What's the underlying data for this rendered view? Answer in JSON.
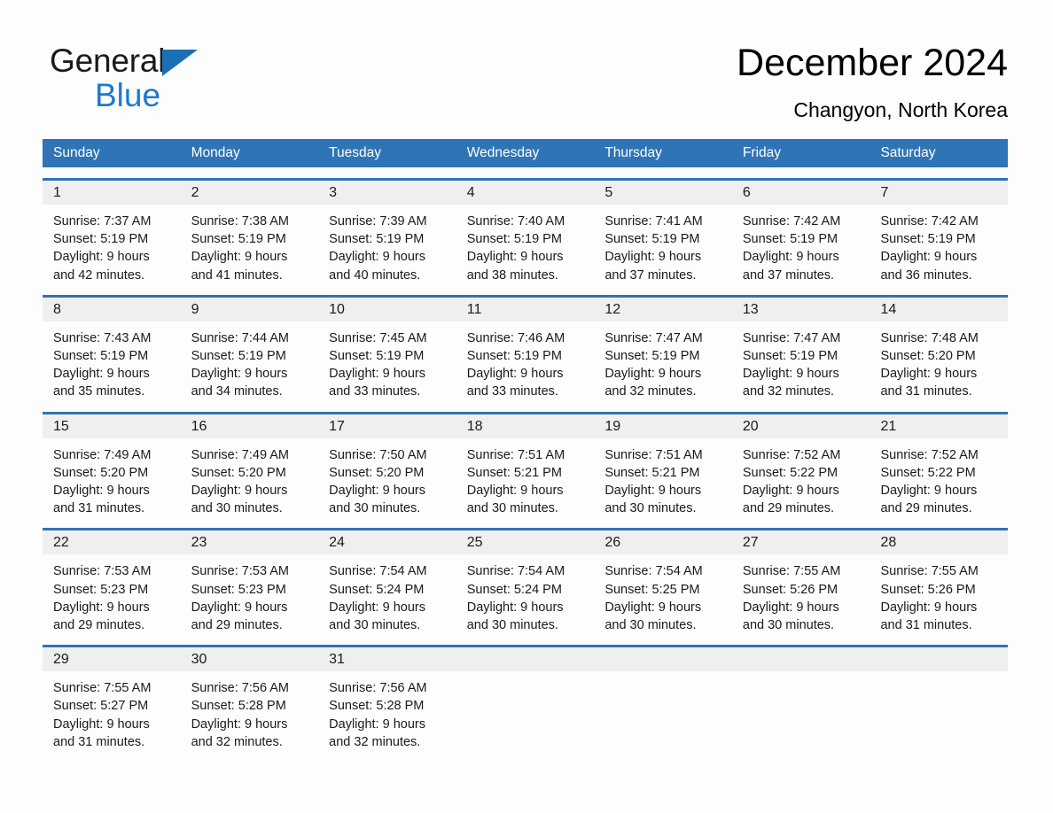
{
  "brand": {
    "name_part1": "General",
    "name_part2": "Blue",
    "triangle_icon": "blue-triangle-icon",
    "accent_color": "#1b7ad0"
  },
  "header": {
    "title": "December 2024",
    "subtitle": "Changyon, North Korea"
  },
  "theme": {
    "header_blue": "#2f74b5",
    "day_band_gray": "#efefef",
    "text_color": "#1a1a1a",
    "page_background": "#fdfdfd"
  },
  "calendar": {
    "weekday_headers": [
      "Sunday",
      "Monday",
      "Tuesday",
      "Wednesday",
      "Thursday",
      "Friday",
      "Saturday"
    ],
    "weeks": [
      [
        {
          "day": "1",
          "sunrise": "Sunrise: 7:37 AM",
          "sunset": "Sunset: 5:19 PM",
          "daylight_line1": "Daylight: 9 hours",
          "daylight_line2": "and 42 minutes."
        },
        {
          "day": "2",
          "sunrise": "Sunrise: 7:38 AM",
          "sunset": "Sunset: 5:19 PM",
          "daylight_line1": "Daylight: 9 hours",
          "daylight_line2": "and 41 minutes."
        },
        {
          "day": "3",
          "sunrise": "Sunrise: 7:39 AM",
          "sunset": "Sunset: 5:19 PM",
          "daylight_line1": "Daylight: 9 hours",
          "daylight_line2": "and 40 minutes."
        },
        {
          "day": "4",
          "sunrise": "Sunrise: 7:40 AM",
          "sunset": "Sunset: 5:19 PM",
          "daylight_line1": "Daylight: 9 hours",
          "daylight_line2": "and 38 minutes."
        },
        {
          "day": "5",
          "sunrise": "Sunrise: 7:41 AM",
          "sunset": "Sunset: 5:19 PM",
          "daylight_line1": "Daylight: 9 hours",
          "daylight_line2": "and 37 minutes."
        },
        {
          "day": "6",
          "sunrise": "Sunrise: 7:42 AM",
          "sunset": "Sunset: 5:19 PM",
          "daylight_line1": "Daylight: 9 hours",
          "daylight_line2": "and 37 minutes."
        },
        {
          "day": "7",
          "sunrise": "Sunrise: 7:42 AM",
          "sunset": "Sunset: 5:19 PM",
          "daylight_line1": "Daylight: 9 hours",
          "daylight_line2": "and 36 minutes."
        }
      ],
      [
        {
          "day": "8",
          "sunrise": "Sunrise: 7:43 AM",
          "sunset": "Sunset: 5:19 PM",
          "daylight_line1": "Daylight: 9 hours",
          "daylight_line2": "and 35 minutes."
        },
        {
          "day": "9",
          "sunrise": "Sunrise: 7:44 AM",
          "sunset": "Sunset: 5:19 PM",
          "daylight_line1": "Daylight: 9 hours",
          "daylight_line2": "and 34 minutes."
        },
        {
          "day": "10",
          "sunrise": "Sunrise: 7:45 AM",
          "sunset": "Sunset: 5:19 PM",
          "daylight_line1": "Daylight: 9 hours",
          "daylight_line2": "and 33 minutes."
        },
        {
          "day": "11",
          "sunrise": "Sunrise: 7:46 AM",
          "sunset": "Sunset: 5:19 PM",
          "daylight_line1": "Daylight: 9 hours",
          "daylight_line2": "and 33 minutes."
        },
        {
          "day": "12",
          "sunrise": "Sunrise: 7:47 AM",
          "sunset": "Sunset: 5:19 PM",
          "daylight_line1": "Daylight: 9 hours",
          "daylight_line2": "and 32 minutes."
        },
        {
          "day": "13",
          "sunrise": "Sunrise: 7:47 AM",
          "sunset": "Sunset: 5:19 PM",
          "daylight_line1": "Daylight: 9 hours",
          "daylight_line2": "and 32 minutes."
        },
        {
          "day": "14",
          "sunrise": "Sunrise: 7:48 AM",
          "sunset": "Sunset: 5:20 PM",
          "daylight_line1": "Daylight: 9 hours",
          "daylight_line2": "and 31 minutes."
        }
      ],
      [
        {
          "day": "15",
          "sunrise": "Sunrise: 7:49 AM",
          "sunset": "Sunset: 5:20 PM",
          "daylight_line1": "Daylight: 9 hours",
          "daylight_line2": "and 31 minutes."
        },
        {
          "day": "16",
          "sunrise": "Sunrise: 7:49 AM",
          "sunset": "Sunset: 5:20 PM",
          "daylight_line1": "Daylight: 9 hours",
          "daylight_line2": "and 30 minutes."
        },
        {
          "day": "17",
          "sunrise": "Sunrise: 7:50 AM",
          "sunset": "Sunset: 5:20 PM",
          "daylight_line1": "Daylight: 9 hours",
          "daylight_line2": "and 30 minutes."
        },
        {
          "day": "18",
          "sunrise": "Sunrise: 7:51 AM",
          "sunset": "Sunset: 5:21 PM",
          "daylight_line1": "Daylight: 9 hours",
          "daylight_line2": "and 30 minutes."
        },
        {
          "day": "19",
          "sunrise": "Sunrise: 7:51 AM",
          "sunset": "Sunset: 5:21 PM",
          "daylight_line1": "Daylight: 9 hours",
          "daylight_line2": "and 30 minutes."
        },
        {
          "day": "20",
          "sunrise": "Sunrise: 7:52 AM",
          "sunset": "Sunset: 5:22 PM",
          "daylight_line1": "Daylight: 9 hours",
          "daylight_line2": "and 29 minutes."
        },
        {
          "day": "21",
          "sunrise": "Sunrise: 7:52 AM",
          "sunset": "Sunset: 5:22 PM",
          "daylight_line1": "Daylight: 9 hours",
          "daylight_line2": "and 29 minutes."
        }
      ],
      [
        {
          "day": "22",
          "sunrise": "Sunrise: 7:53 AM",
          "sunset": "Sunset: 5:23 PM",
          "daylight_line1": "Daylight: 9 hours",
          "daylight_line2": "and 29 minutes."
        },
        {
          "day": "23",
          "sunrise": "Sunrise: 7:53 AM",
          "sunset": "Sunset: 5:23 PM",
          "daylight_line1": "Daylight: 9 hours",
          "daylight_line2": "and 29 minutes."
        },
        {
          "day": "24",
          "sunrise": "Sunrise: 7:54 AM",
          "sunset": "Sunset: 5:24 PM",
          "daylight_line1": "Daylight: 9 hours",
          "daylight_line2": "and 30 minutes."
        },
        {
          "day": "25",
          "sunrise": "Sunrise: 7:54 AM",
          "sunset": "Sunset: 5:24 PM",
          "daylight_line1": "Daylight: 9 hours",
          "daylight_line2": "and 30 minutes."
        },
        {
          "day": "26",
          "sunrise": "Sunrise: 7:54 AM",
          "sunset": "Sunset: 5:25 PM",
          "daylight_line1": "Daylight: 9 hours",
          "daylight_line2": "and 30 minutes."
        },
        {
          "day": "27",
          "sunrise": "Sunrise: 7:55 AM",
          "sunset": "Sunset: 5:26 PM",
          "daylight_line1": "Daylight: 9 hours",
          "daylight_line2": "and 30 minutes."
        },
        {
          "day": "28",
          "sunrise": "Sunrise: 7:55 AM",
          "sunset": "Sunset: 5:26 PM",
          "daylight_line1": "Daylight: 9 hours",
          "daylight_line2": "and 31 minutes."
        }
      ],
      [
        {
          "day": "29",
          "sunrise": "Sunrise: 7:55 AM",
          "sunset": "Sunset: 5:27 PM",
          "daylight_line1": "Daylight: 9 hours",
          "daylight_line2": "and 31 minutes."
        },
        {
          "day": "30",
          "sunrise": "Sunrise: 7:56 AM",
          "sunset": "Sunset: 5:28 PM",
          "daylight_line1": "Daylight: 9 hours",
          "daylight_line2": "and 32 minutes."
        },
        {
          "day": "31",
          "sunrise": "Sunrise: 7:56 AM",
          "sunset": "Sunset: 5:28 PM",
          "daylight_line1": "Daylight: 9 hours",
          "daylight_line2": "and 32 minutes."
        },
        {
          "day": "",
          "sunrise": "",
          "sunset": "",
          "daylight_line1": "",
          "daylight_line2": ""
        },
        {
          "day": "",
          "sunrise": "",
          "sunset": "",
          "daylight_line1": "",
          "daylight_line2": ""
        },
        {
          "day": "",
          "sunrise": "",
          "sunset": "",
          "daylight_line1": "",
          "daylight_line2": ""
        },
        {
          "day": "",
          "sunrise": "",
          "sunset": "",
          "daylight_line1": "",
          "daylight_line2": ""
        }
      ]
    ]
  }
}
